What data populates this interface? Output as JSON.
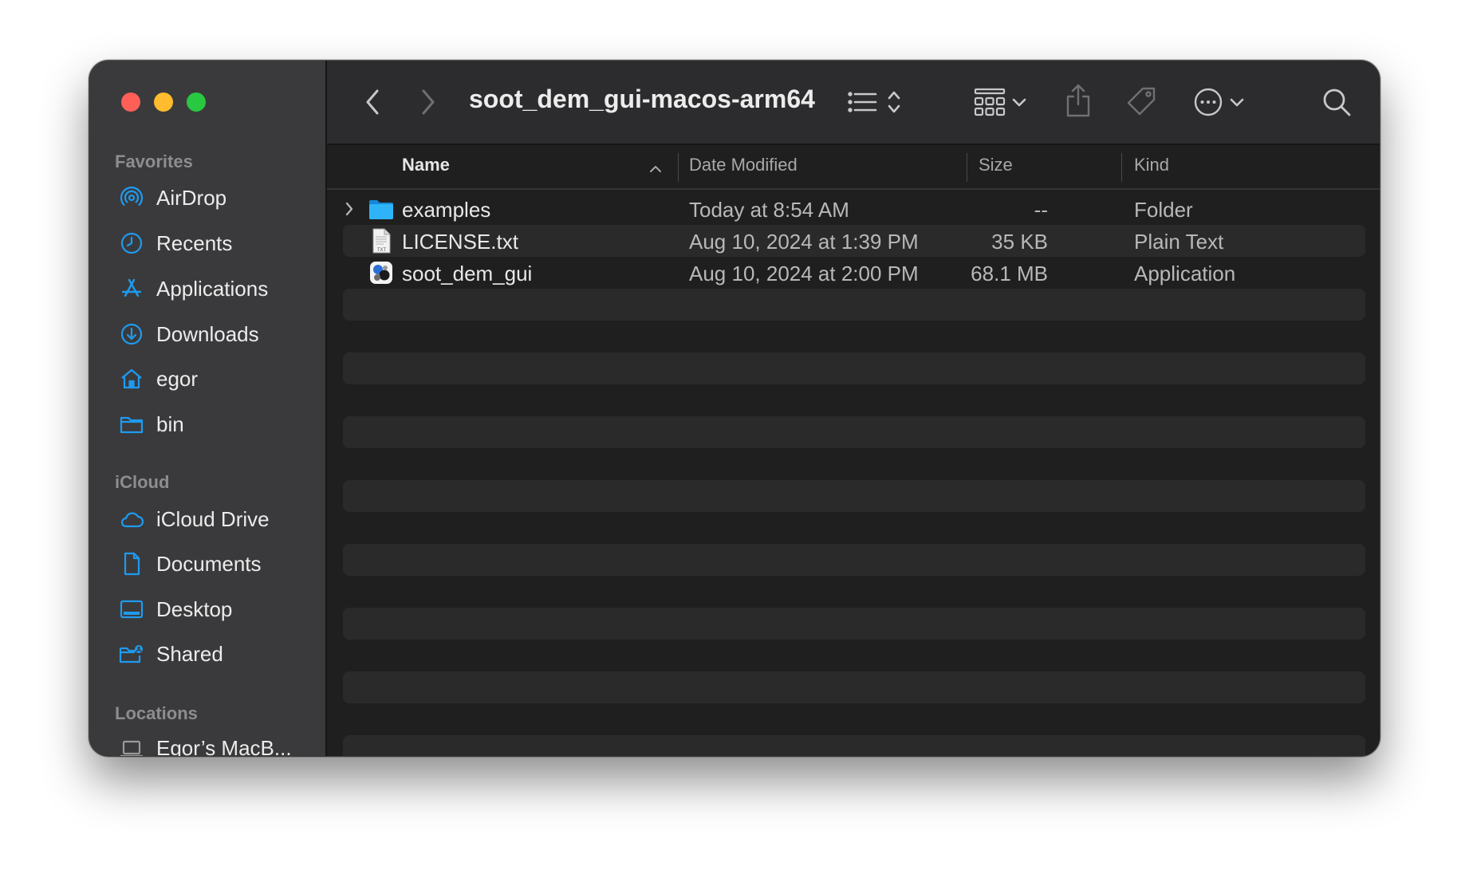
{
  "window": {
    "title": "soot_dem_gui-macos-arm64"
  },
  "sidebar": {
    "sections": [
      {
        "title": "Favorites",
        "items": [
          {
            "label": "AirDrop",
            "icon": "airdrop-icon"
          },
          {
            "label": "Recents",
            "icon": "clock-icon"
          },
          {
            "label": "Applications",
            "icon": "applications-icon"
          },
          {
            "label": "Downloads",
            "icon": "download-icon"
          },
          {
            "label": "egor",
            "icon": "home-icon"
          },
          {
            "label": "bin",
            "icon": "folder-icon"
          }
        ]
      },
      {
        "title": "iCloud",
        "items": [
          {
            "label": "iCloud Drive",
            "icon": "cloud-icon"
          },
          {
            "label": "Documents",
            "icon": "document-icon"
          },
          {
            "label": "Desktop",
            "icon": "desktop-icon"
          },
          {
            "label": "Shared",
            "icon": "shared-folder-icon"
          }
        ]
      },
      {
        "title": "Locations",
        "items": [
          {
            "label": "Egor’s MacB...",
            "icon": "laptop-icon"
          }
        ]
      }
    ]
  },
  "columns": {
    "name": "Name",
    "date": "Date Modified",
    "size": "Size",
    "kind": "Kind"
  },
  "files": [
    {
      "name": "examples",
      "date": "Today at 8:54 AM",
      "size": "--",
      "kind": "Folder",
      "icon": "folder-icon",
      "expandable": true
    },
    {
      "name": "LICENSE.txt",
      "date": "Aug 10, 2024 at 1:39 PM",
      "size": "35 KB",
      "kind": "Plain Text",
      "icon": "text-file-icon",
      "icon_label": "TXT"
    },
    {
      "name": "soot_dem_gui",
      "date": "Aug 10, 2024 at 2:00 PM",
      "size": "68.1 MB",
      "kind": "Application",
      "icon": "app-icon"
    }
  ],
  "colors": {
    "accent": "#0a84ff",
    "close": "#fe5f57",
    "minimize": "#febc2e",
    "zoom": "#28c840",
    "folder": "#1ba1f0"
  }
}
